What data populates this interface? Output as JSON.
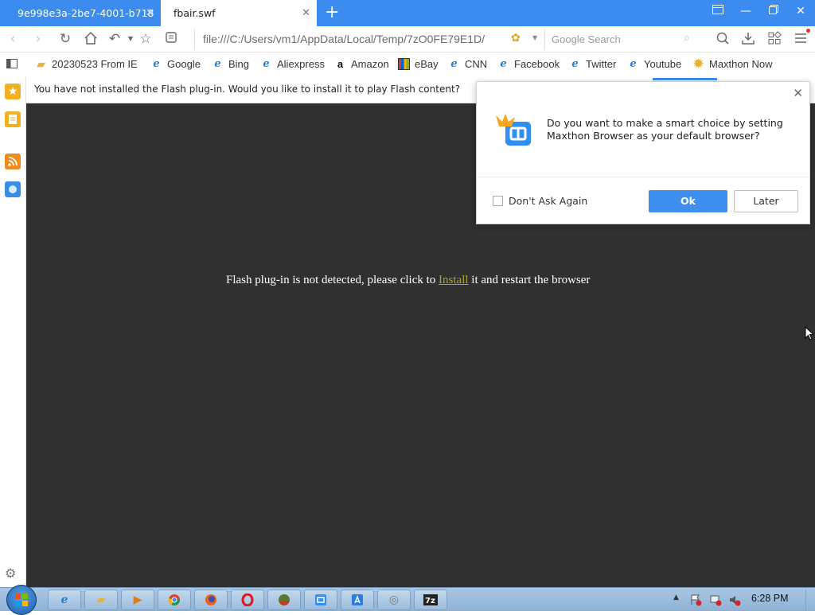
{
  "tabs": [
    {
      "label": "9e998e3a-2be7-4001-b718",
      "active": false
    },
    {
      "label": "fbair.swf",
      "active": true
    }
  ],
  "navbar": {
    "address": "file:///C:/Users/vm1/AppData/Local/Temp/7zO0FE79E1D/",
    "search_placeholder": "Google Search"
  },
  "bookmarks": [
    {
      "label": "20230523 From IE",
      "icon": "folder-icon"
    },
    {
      "label": "Google",
      "icon": "ie-icon"
    },
    {
      "label": "Bing",
      "icon": "ie-icon"
    },
    {
      "label": "Aliexpress",
      "icon": "ie-icon"
    },
    {
      "label": "Amazon",
      "icon": "amazon-icon"
    },
    {
      "label": "eBay",
      "icon": "ebay-icon"
    },
    {
      "label": "CNN",
      "icon": "ie-icon"
    },
    {
      "label": "Facebook",
      "icon": "ie-icon"
    },
    {
      "label": "Twitter",
      "icon": "ie-icon"
    },
    {
      "label": "Youtube",
      "icon": "ie-icon"
    },
    {
      "label": "Maxthon Now",
      "icon": "maxthon-now-icon"
    }
  ],
  "notice": {
    "text": "You have not installed the Flash plug-in. Would you like to install it to play Flash content?"
  },
  "content": {
    "before": "Flash plug-in is not detected, please click to ",
    "link": "Install",
    "after": " it and restart the browser"
  },
  "dialog": {
    "message": "Do you want to make a smart choice by setting Maxthon Browser as your default browser?",
    "checkbox_label": "Don't Ask Again",
    "ok_label": "Ok",
    "later_label": "Later"
  },
  "taskbar": {
    "clock": "6:28 PM"
  },
  "colors": {
    "tabbar": "#3c8cef",
    "content_bg": "#303030",
    "link": "#a8a038",
    "ok_button": "#3d8eef"
  }
}
